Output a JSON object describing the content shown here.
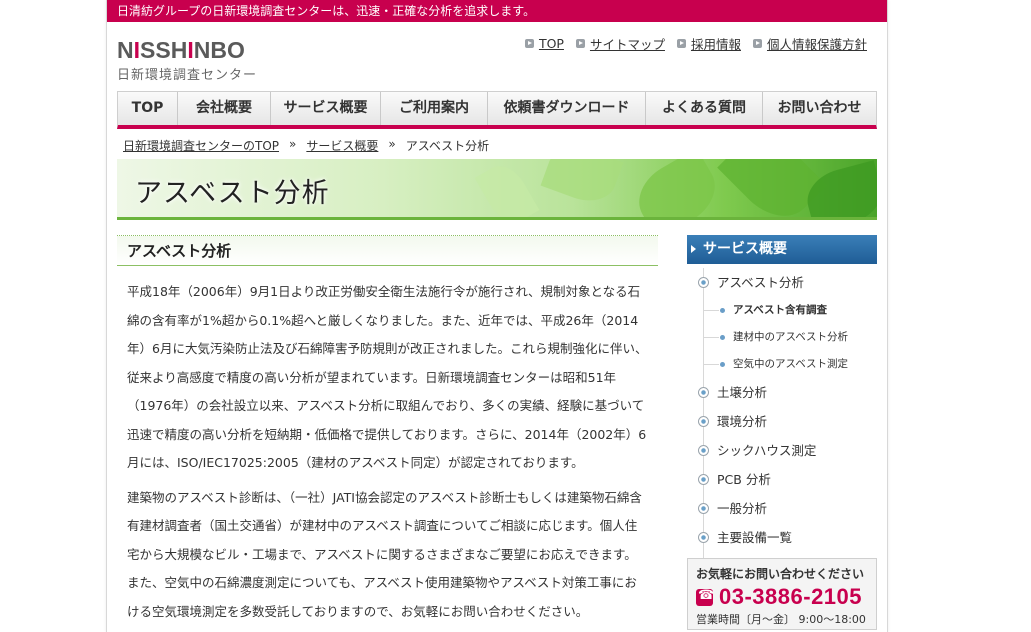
{
  "header": {
    "tagline": "日清紡グループの日新環境調査センターは、迅速・正確な分析を追求します。",
    "logo_brand": "NISSHINBO",
    "logo_sub": "日新環境調査センター",
    "links": [
      "TOP",
      "サイトマップ",
      "採用情報",
      "個人情報保護方針"
    ]
  },
  "nav": {
    "items": [
      "TOP",
      "会社概要",
      "サービス概要",
      "ご利用案内",
      "依頼書ダウンロード",
      "よくある質問",
      "お問い合わせ"
    ]
  },
  "breadcrumb": {
    "home": "日新環境調査センターのTOP",
    "sep1": "»",
    "parent": "サービス概要",
    "sep2": "»",
    "current": "アスベスト分析"
  },
  "hero": {
    "title": "アスベスト分析"
  },
  "main": {
    "section_title": "アスベスト分析",
    "para1": "平成18年（2006年）9月1日より改正労働安全衛生法施行令が施行され、規制対象となる石綿の含有率が1%超から0.1%超へと厳しくなりました。また、近年では、平成26年（2014年）6月に大気汚染防止法及び石綿障害予防規則が改正されました。これら規制強化に伴い、従来より高感度で精度の高い分析が望まれています。日新環境調査センターは昭和51年（1976年）の会社設立以来、アスベスト分析に取組んでおり、多くの実績、経験に基づいて迅速で精度の高い分析を短納期・低価格で提供しております。さらに、2014年（2002年）6月には、ISO/IEC17025:2005（建材のアスベスト同定）が認定されております。",
    "para2": "建築物のアスベスト診断は、（一社）JATI協会認定のアスベスト診断士もしくは建築物石綿含有建材調査者（国土交通省）が建材中のアスベスト調査についてご相談に応じます。個人住宅から大規模なビル・工場まで、アスベストに関するさまざまなご要望にお応えできます。また、空気中の石綿濃度測定についても、アスベスト使用建築物やアスベスト対策工事における空気環境測定を多数受託しておりますので、お気軽にお問い合わせください。"
  },
  "sidebar": {
    "title": "サービス概要",
    "items": [
      {
        "label": "アスベスト分析"
      },
      {
        "label": "アスベスト含有調査"
      },
      {
        "label": "建材中のアスベスト分析"
      },
      {
        "label": "空気中のアスベスト測定"
      },
      {
        "label": "土壌分析"
      },
      {
        "label": "環境分析"
      },
      {
        "label": "シックハウス測定"
      },
      {
        "label": "PCB 分析"
      },
      {
        "label": "一般分析"
      },
      {
        "label": "主要設備一覧"
      }
    ]
  },
  "contact": {
    "title": "お気軽にお問い合わせください",
    "phone": "03-3886-2105",
    "hours": "営業時間〔月～金〕 9:00～18:00"
  },
  "colors": {
    "brand": "#c8004e",
    "sidebar_head": "#1f5d96",
    "accent_green": "#8cc063"
  }
}
